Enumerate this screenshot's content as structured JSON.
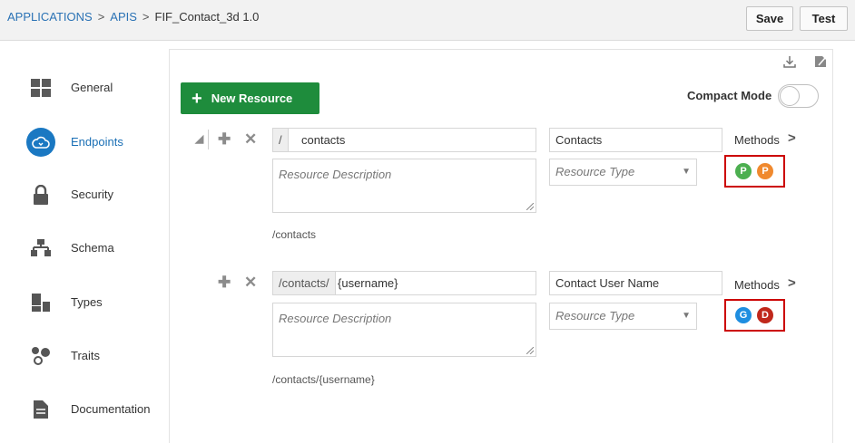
{
  "breadcrumb": {
    "items": [
      "APPLICATIONS",
      "APIS"
    ],
    "separator": ">",
    "current": "FIF_Contact_3d  1.0"
  },
  "toolbar": {
    "save_label": "Save",
    "test_label": "Test"
  },
  "sidebar": {
    "items": [
      {
        "label": "General",
        "icon": "grid-icon"
      },
      {
        "label": "Endpoints",
        "icon": "cloud-icon",
        "active": true
      },
      {
        "label": "Security",
        "icon": "lock-icon"
      },
      {
        "label": "Schema",
        "icon": "hierarchy-icon"
      },
      {
        "label": "Types",
        "icon": "types-icon"
      },
      {
        "label": "Traits",
        "icon": "traits-icon"
      },
      {
        "label": "Documentation",
        "icon": "document-icon"
      }
    ]
  },
  "panel": {
    "new_resource_label": "New Resource",
    "compact_mode_label": "Compact Mode",
    "compact_mode_on": false
  },
  "resources": [
    {
      "path_prefix": "/",
      "path_value": "contacts",
      "name": "Contacts",
      "description_placeholder": "Resource Description",
      "type_placeholder": "Resource Type",
      "methods_label": "Methods",
      "methods": [
        {
          "letter": "P",
          "color": "#4caf50"
        },
        {
          "letter": "P",
          "color": "#f0892e"
        }
      ],
      "full_path": "/contacts"
    },
    {
      "path_prefix": "/contacts/",
      "path_value": "{username}",
      "name": "Contact User Name",
      "description_placeholder": "Resource Description",
      "type_placeholder": "Resource Type",
      "methods_label": "Methods",
      "methods": [
        {
          "letter": "G",
          "color": "#1f8ee0"
        },
        {
          "letter": "D",
          "color": "#c0281b"
        }
      ],
      "full_path": "/contacts/{username}"
    }
  ],
  "colors": {
    "accent": "#1a78c2",
    "new_resource": "#1e8c3c",
    "highlight_border": "#cc0000"
  }
}
